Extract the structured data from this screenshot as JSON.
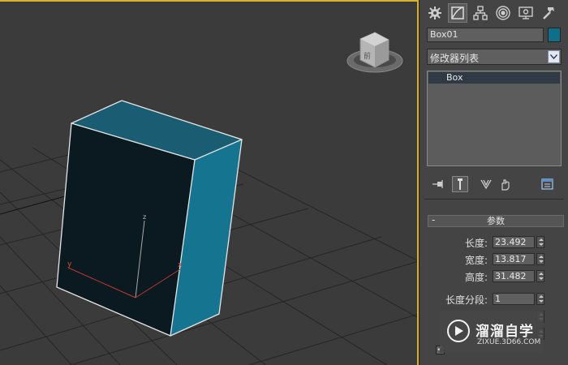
{
  "object_name": "Box01",
  "object_color": "#0f6f88",
  "modifier_list_label": "修改器列表",
  "modifier_stack": [
    "Box"
  ],
  "panel_tabs": [
    "create-icon",
    "modify-icon",
    "hierarchy-icon",
    "motion-icon",
    "display-icon",
    "utilities-icon"
  ],
  "stack_tools": [
    "pin-stack-icon",
    "show-end-result-icon",
    "make-unique-icon",
    "remove-modifier-icon",
    "configure-sets-icon"
  ],
  "rollout": {
    "title": "参数",
    "collapse": "-",
    "length_label": "长度:",
    "length_value": "23.492",
    "width_label": "宽度:",
    "width_value": "13.817",
    "height_label": "高度:",
    "height_value": "31.482",
    "length_segs_label": "长度分段:",
    "length_segs_value": "1"
  },
  "viewport": {
    "axis_labels": {
      "x": "x",
      "y": "y",
      "z": "z"
    },
    "viewcube_face": "前"
  },
  "watermark": {
    "title": "溜溜自学",
    "url": "ZIXUE.3D66.COM"
  }
}
